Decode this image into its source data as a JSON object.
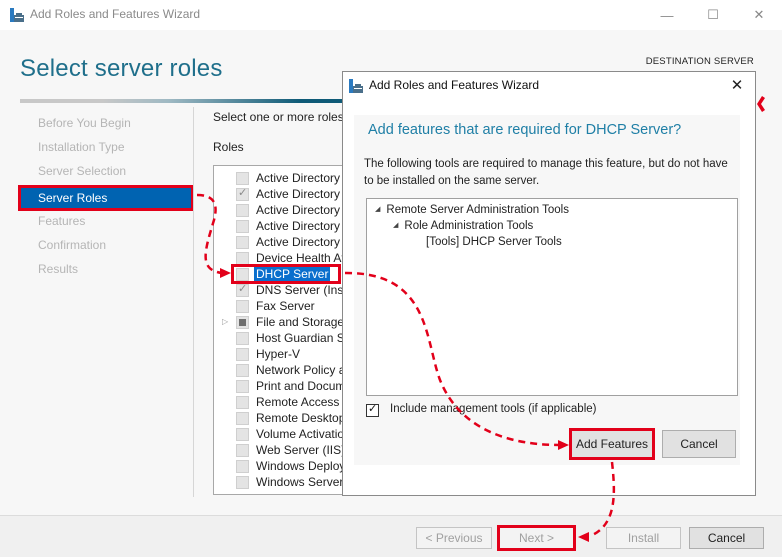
{
  "window": {
    "title": "Add Roles and Features Wizard",
    "controls": {
      "minimize": "—",
      "maximize": "☐",
      "close": "✕"
    }
  },
  "header": {
    "page_title": "Select server roles",
    "destination_label": "DESTINATION SERVER"
  },
  "steps": [
    {
      "label": "Before You Begin",
      "active": false
    },
    {
      "label": "Installation Type",
      "active": false
    },
    {
      "label": "Server Selection",
      "active": false
    },
    {
      "label": "Server Roles",
      "active": true
    },
    {
      "label": "Features",
      "active": false
    },
    {
      "label": "Confirmation",
      "active": false
    },
    {
      "label": "Results",
      "active": false
    }
  ],
  "main": {
    "intro": "Select one or more roles",
    "roles_heading": "Roles",
    "roles": [
      {
        "label": "Active Directory",
        "state": "unchecked"
      },
      {
        "label": "Active Directory",
        "state": "checked"
      },
      {
        "label": "Active Directory",
        "state": "unchecked"
      },
      {
        "label": "Active Directory",
        "state": "unchecked"
      },
      {
        "label": "Active Directory",
        "state": "unchecked"
      },
      {
        "label": "Device Health At",
        "state": "unchecked"
      },
      {
        "label": "DHCP Server",
        "state": "unchecked",
        "selected": true
      },
      {
        "label": "DNS Server (Inst",
        "state": "checked"
      },
      {
        "label": "Fax Server",
        "state": "unchecked"
      },
      {
        "label": "File and Storage",
        "state": "partial",
        "expandable": true
      },
      {
        "label": "Host Guardian Se",
        "state": "unchecked"
      },
      {
        "label": "Hyper-V",
        "state": "unchecked"
      },
      {
        "label": "Network Policy a",
        "state": "unchecked"
      },
      {
        "label": "Print and Docum",
        "state": "unchecked"
      },
      {
        "label": "Remote Access",
        "state": "unchecked"
      },
      {
        "label": "Remote Desktop",
        "state": "unchecked"
      },
      {
        "label": "Volume Activatio",
        "state": "unchecked"
      },
      {
        "label": "Web Server (IIS)",
        "state": "unchecked"
      },
      {
        "label": "Windows Deploy",
        "state": "unchecked"
      },
      {
        "label": "Windows Server",
        "state": "unchecked"
      }
    ]
  },
  "footer": {
    "previous": "< Previous",
    "next": "Next >",
    "install": "Install",
    "cancel": "Cancel"
  },
  "dialog": {
    "title": "Add Roles and Features Wizard",
    "close": "✕",
    "heading": "Add features that are required for DHCP Server?",
    "description": "The following tools are required to manage this feature, but do not have to be installed on the same server.",
    "tree": [
      {
        "label": "Remote Server Administration Tools",
        "level": 0,
        "expanded": true
      },
      {
        "label": "Role Administration Tools",
        "level": 1,
        "expanded": true
      },
      {
        "label": "[Tools] DHCP Server Tools",
        "level": 2,
        "expanded": false
      }
    ],
    "include_mgmt_label": "Include management tools (if applicable)",
    "include_mgmt_checked": true,
    "add_features": "Add Features",
    "cancel": "Cancel"
  },
  "annotations": {
    "highlight_color": "#e2001a"
  }
}
